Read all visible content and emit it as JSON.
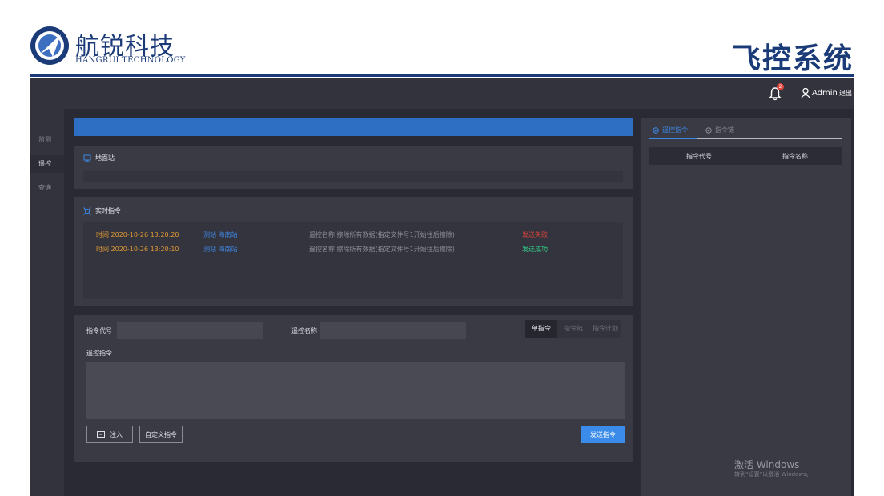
{
  "brand": {
    "name_cn": "航锐科技",
    "name_en": "HANGRUI TECHNOLOGY",
    "system_title": "飞控系统"
  },
  "colors": {
    "brand": "#1a3a78",
    "accent": "#3a8bea",
    "app_bg": "#2a2a34",
    "panel": "#3a3a44",
    "time": "#e09a34",
    "station": "#3f86e0",
    "fail": "#e0443a",
    "success": "#2fcf8a"
  },
  "topbar": {
    "notification_count": "2",
    "user": "Admin",
    "logout": "退出"
  },
  "sidebar": {
    "items": [
      {
        "label": "监测"
      },
      {
        "label": "遥控",
        "active": true
      },
      {
        "label": "查询"
      }
    ]
  },
  "ground_station": {
    "title": "地面站"
  },
  "realtime": {
    "title": "实时指令",
    "rows": [
      {
        "time": "时间 2020-10-26 13:20:20",
        "station": "测站 海南站",
        "desc": "遥控名称 擦除所有数据(指定文件号1开始往后擦除)",
        "status": "发送失败",
        "status_type": "fail"
      },
      {
        "time": "时间 2020-10-26 13:20:10",
        "station": "测站 海南站",
        "desc": "遥控名称 擦除所有数据(指定文件号1开始往后擦除)",
        "status": "发送成功",
        "status_type": "success"
      }
    ]
  },
  "command_form": {
    "code_label": "指令代号",
    "code_value": "",
    "name_label": "遥控名称",
    "name_value": "",
    "modes": [
      {
        "label": "单指令",
        "active": true
      },
      {
        "label": "指令链"
      },
      {
        "label": "指令计划"
      }
    ],
    "command_label": "遥控指令",
    "command_value": "",
    "inject_label": "注入",
    "custom_label": "自定义指令",
    "send_label": "发送指令"
  },
  "right_panel": {
    "tabs": [
      {
        "label": "遥控指令",
        "active": true
      },
      {
        "label": "指令链"
      }
    ],
    "columns": [
      "指令代号",
      "指令名称"
    ]
  },
  "watermark": {
    "line1": "激活 Windows",
    "line2": "转到“设置”以激活 Windows。"
  }
}
